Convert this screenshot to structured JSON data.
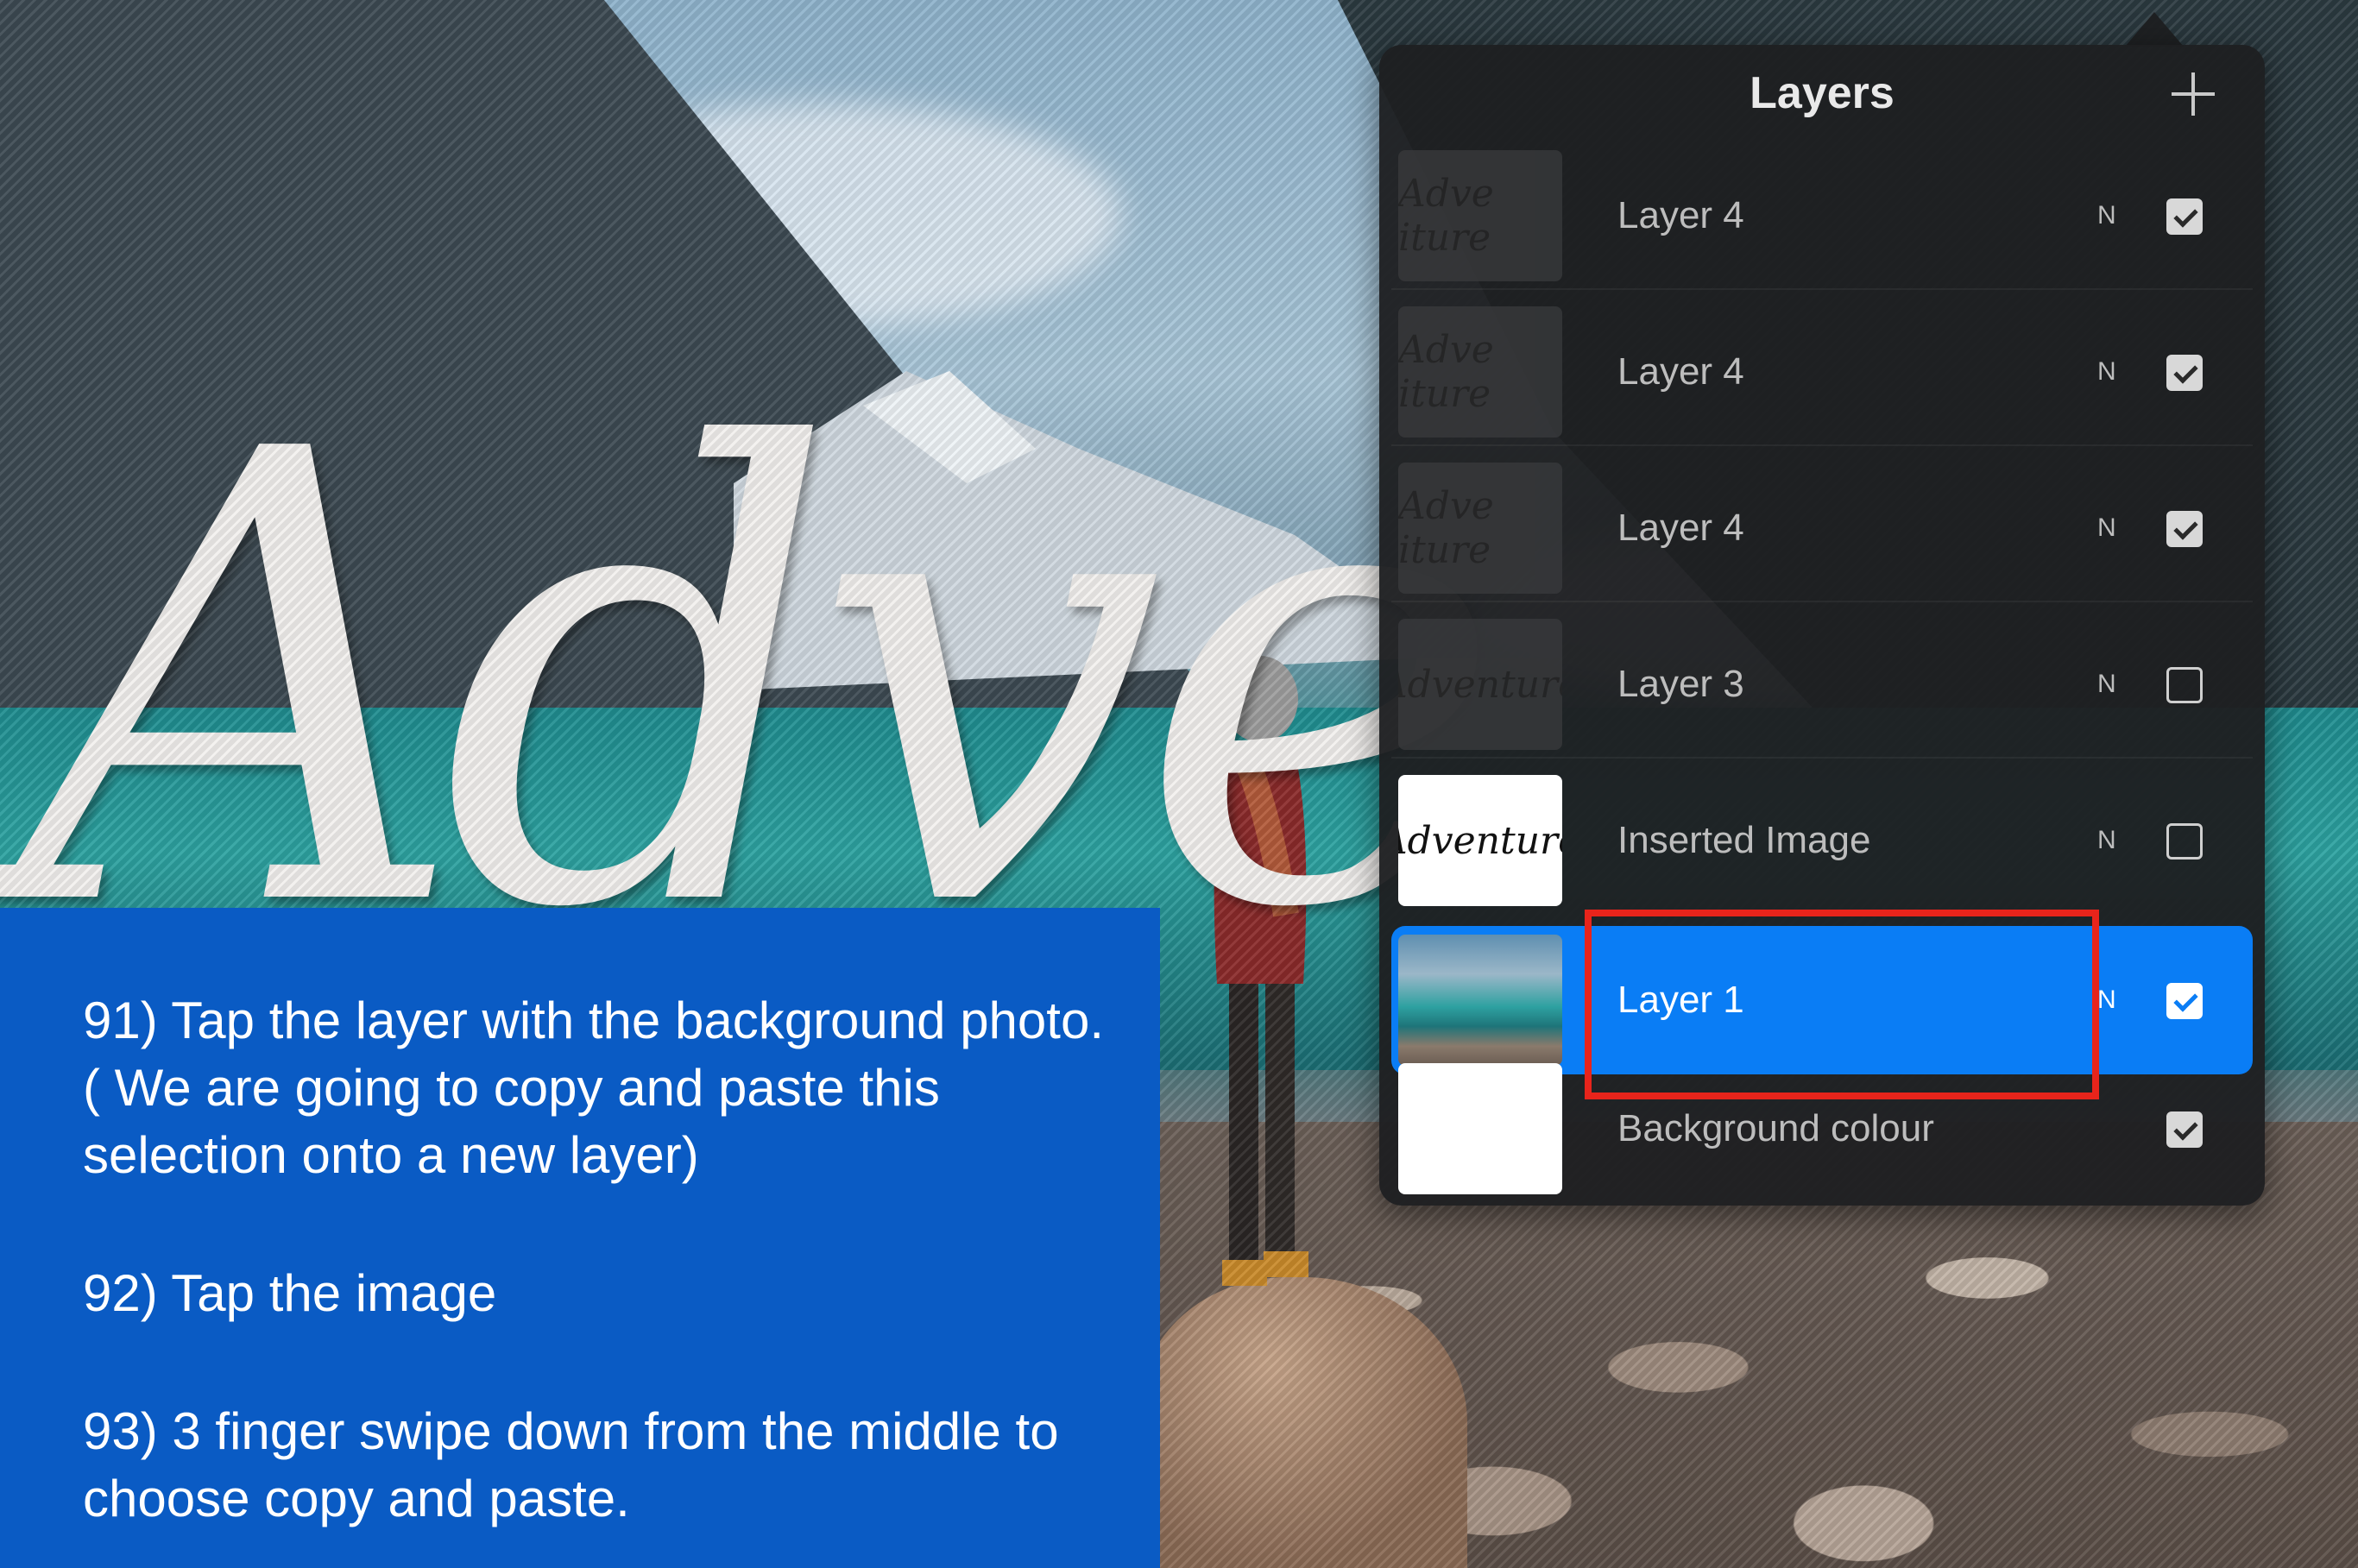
{
  "panel": {
    "title": "Layers",
    "add_icon": "plus-icon"
  },
  "layers": [
    {
      "thumb_text": "Adve iture",
      "name": "Layer 4",
      "blend": "N",
      "visible": true
    },
    {
      "thumb_text": "Adve iture",
      "name": "Layer 4",
      "blend": "N",
      "visible": true
    },
    {
      "thumb_text": "Adve iture",
      "name": "Layer 4",
      "blend": "N",
      "visible": true
    },
    {
      "thumb_text": "Adventure",
      "name": "Layer 3",
      "blend": "N",
      "visible": false
    },
    {
      "thumb_text": "Adventure",
      "name": "Inserted Image",
      "blend": "N",
      "visible": false
    },
    {
      "thumb_text": "",
      "name": "Layer 1",
      "blend": "N",
      "visible": true,
      "selected": true
    },
    {
      "thumb_text": "",
      "name": "Background colour",
      "blend": "",
      "visible": true
    }
  ],
  "instructions": [
    "91) Tap the layer with the background photo. ( We are going to copy and paste this selection onto a new layer)",
    "92) Tap the image",
    "93) 3 finger swipe down from the middle to choose copy and paste."
  ],
  "colors": {
    "instruction_bg": "#0a5bc4",
    "selected_layer": "#0a7df5",
    "highlight_border": "#e8241b"
  }
}
